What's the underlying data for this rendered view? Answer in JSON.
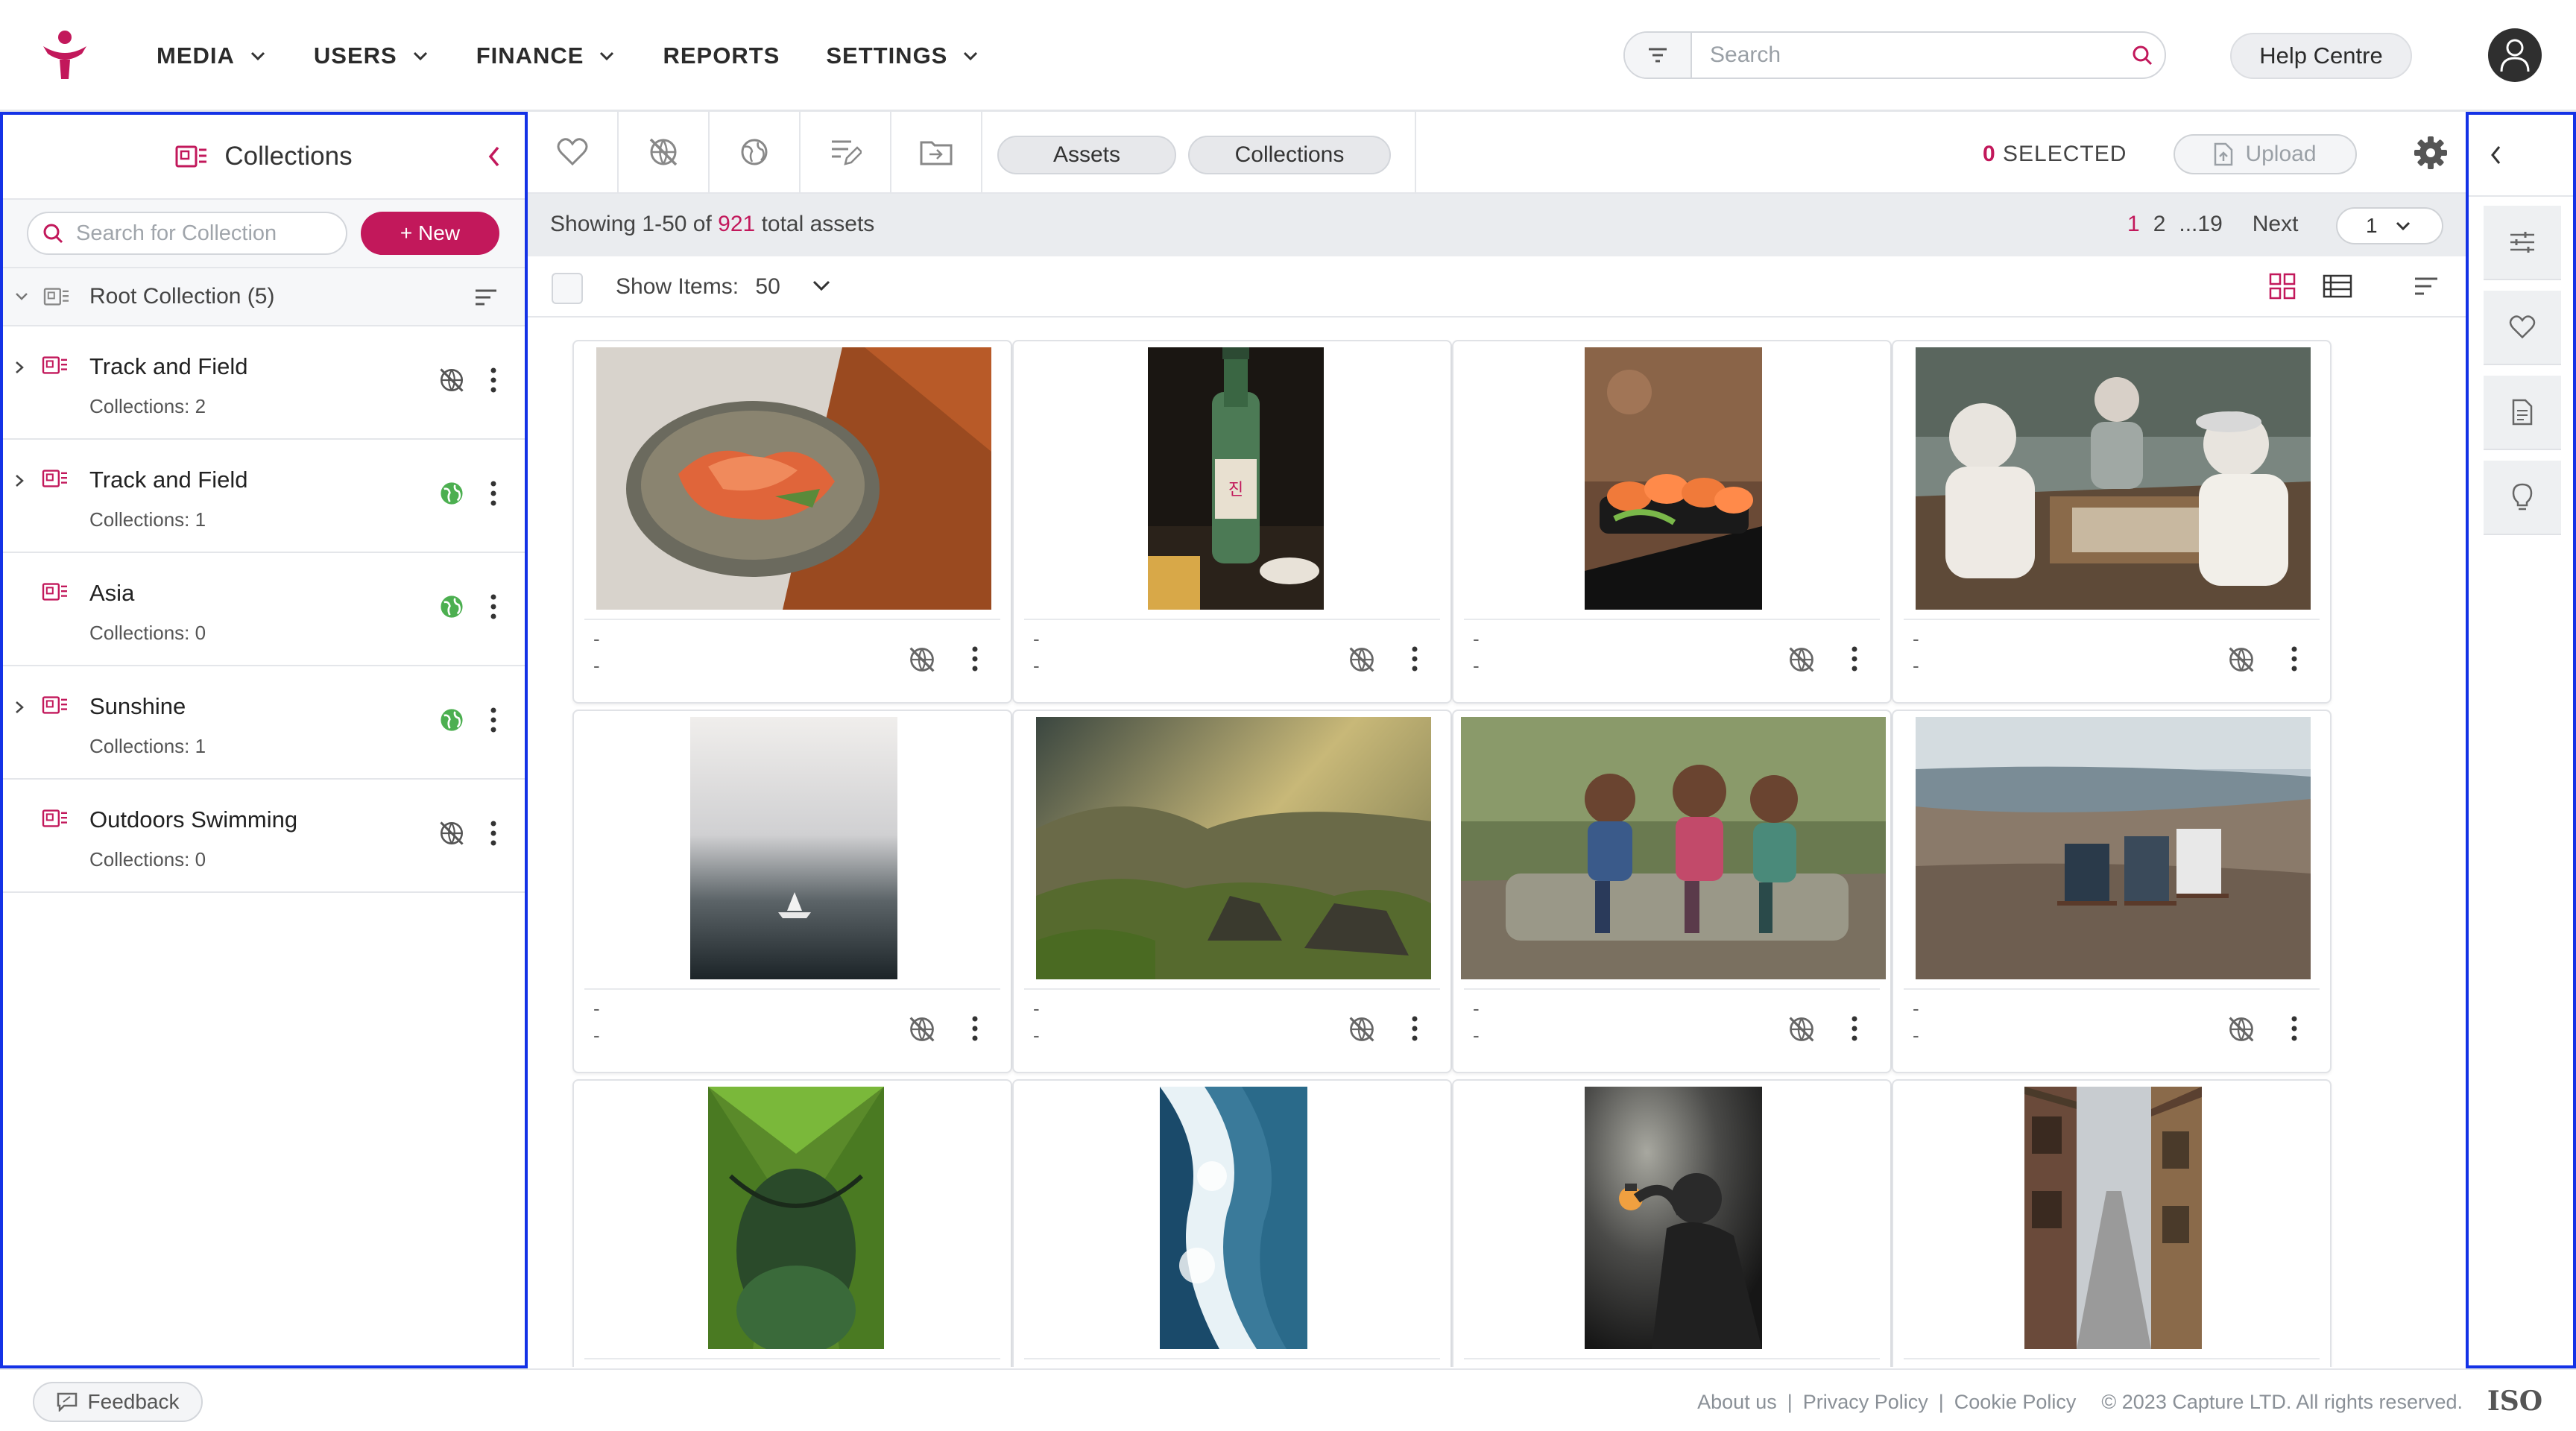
{
  "colors": {
    "accent": "#c2185b",
    "highlight_border": "#1432e6",
    "public_green": "#4caf50"
  },
  "nav": {
    "menu": [
      {
        "label": "MEDIA",
        "has_dropdown": true
      },
      {
        "label": "USERS",
        "has_dropdown": true
      },
      {
        "label": "FINANCE",
        "has_dropdown": true
      },
      {
        "label": "REPORTS",
        "has_dropdown": false
      },
      {
        "label": "SETTINGS",
        "has_dropdown": true
      }
    ],
    "search_placeholder": "Search",
    "help_label": "Help Centre"
  },
  "sidebar": {
    "title": "Collections",
    "search_placeholder": "Search for Collection",
    "new_label": "+ New",
    "root_label": "Root Collection (5)",
    "items": [
      {
        "name": "Track and Field",
        "count": "Collections: 2",
        "expandable": true,
        "visibility": "private"
      },
      {
        "name": "Track and Field",
        "count": "Collections: 1",
        "expandable": true,
        "visibility": "public"
      },
      {
        "name": "Asia",
        "count": "Collections: 0",
        "expandable": false,
        "visibility": "public"
      },
      {
        "name": "Sunshine",
        "count": "Collections: 1",
        "expandable": true,
        "visibility": "public"
      },
      {
        "name": "Outdoors Swimming",
        "count": "Collections: 0",
        "expandable": false,
        "visibility": "private"
      }
    ]
  },
  "toolbar": {
    "tab_assets": "Assets",
    "tab_collections": "Collections",
    "selected_count": "0",
    "selected_label": "SELECTED",
    "upload_label": "Upload"
  },
  "info": {
    "showing_prefix": "Showing 1-50 of",
    "total": "921",
    "showing_suffix": "total assets",
    "pages": [
      "1",
      "2",
      "...19"
    ],
    "next_label": "Next",
    "page_select_value": "1"
  },
  "items_bar": {
    "label": "Show Items:",
    "value": "50"
  },
  "assets": [
    {
      "meta1": "-",
      "meta2": "-",
      "subject": "food-bowl"
    },
    {
      "meta1": "-",
      "meta2": "-",
      "subject": "soju-bottle"
    },
    {
      "meta1": "-",
      "meta2": "-",
      "subject": "sushi"
    },
    {
      "meta1": "-",
      "meta2": "-",
      "subject": "chess-players"
    },
    {
      "meta1": "-",
      "meta2": "-",
      "subject": "misty-boat"
    },
    {
      "meta1": "-",
      "meta2": "-",
      "subject": "mountains"
    },
    {
      "meta1": "-",
      "meta2": "-",
      "subject": "children"
    },
    {
      "meta1": "-",
      "meta2": "-",
      "subject": "beach-chairs"
    },
    {
      "meta1": "",
      "meta2": "",
      "subject": "tent"
    },
    {
      "meta1": "",
      "meta2": "",
      "subject": "waves"
    },
    {
      "meta1": "",
      "meta2": "",
      "subject": "lantern-man"
    },
    {
      "meta1": "",
      "meta2": "",
      "subject": "old-street"
    }
  ],
  "footer": {
    "feedback_label": "Feedback",
    "links": [
      "About us",
      "Privacy Policy",
      "Cookie Policy"
    ],
    "copyright": "© 2023 Capture LTD. All rights reserved.",
    "badge": "ISO"
  }
}
